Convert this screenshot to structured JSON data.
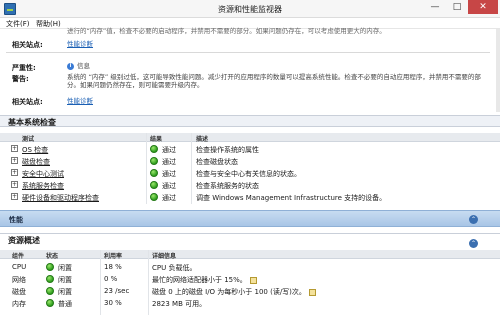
{
  "window": {
    "title": "资源和性能监视器",
    "minimize": "—",
    "maximize": "□",
    "close": "✕"
  },
  "menu": [
    "文件(F)",
    "帮助(H)"
  ],
  "warnings": {
    "top_snippet": "进行的“内存”值，检查不必要的启动程序，并禁用不需要的部分。如果问题仍存在，可以考虑使用更大的内存。",
    "related1_label": "相关站点:",
    "related1_link": "性能诊断",
    "severity_label": "严重性:",
    "severity_value": "信息",
    "warning_label": "警告:",
    "warning_text": "系统的 “内存” 级别过低，这可能导致性能问题。减少打开的应用程序的数量可以提高系统性能。检查不必要的自动应用程序，并禁用不需要的部分。如果问题仍然存在，则可能需要升级内存。",
    "related2_label": "相关站点:",
    "related2_link": "性能诊断"
  },
  "basic_checks": {
    "title": "基本系统检查",
    "headers": {
      "test": "测试",
      "result": "结果",
      "desc": "描述"
    },
    "rows": [
      {
        "test": "OS 检查",
        "result": "通过",
        "desc": "检查操作系统的属性"
      },
      {
        "test": "磁盘检查",
        "result": "通过",
        "desc": "检查磁盘状态"
      },
      {
        "test": "安全中心测试",
        "result": "通过",
        "desc": "检查与安全中心有关信息的状态。"
      },
      {
        "test": "系统服务检查",
        "result": "通过",
        "desc": "检查系统服务的状态"
      },
      {
        "test": "硬件设备和驱动程序检查",
        "result": "通过",
        "desc": "调查 Windows Management Infrastructure 支持的设备。"
      }
    ]
  },
  "performance": {
    "title": "性能",
    "collapse": "⌃"
  },
  "resources": {
    "title": "资源概述",
    "headers": {
      "component": "组件",
      "status": "状态",
      "usage": "利用率",
      "details": "详细信息"
    },
    "rows": [
      {
        "component": "CPU",
        "status": "闲置",
        "usage": "18 %",
        "details": "CPU 负载低。"
      },
      {
        "component": "网络",
        "status": "闲置",
        "usage": "0 %",
        "details": "最忙的网络适配器小于 15%。"
      },
      {
        "component": "磁盘",
        "status": "闲置",
        "usage": "23 /sec",
        "details": "磁盘 0 上的磁盘 I/O 为每秒小于 100 (读/写)次。"
      },
      {
        "component": "内存",
        "status": "普通",
        "usage": "30 %",
        "details": "2823 MB 可用。"
      }
    ]
  },
  "colors": {
    "link": "#1a5fb4",
    "ok_green": "#2f9e1e",
    "header_blue": "#a8c5e6",
    "close_red": "#c74646"
  }
}
